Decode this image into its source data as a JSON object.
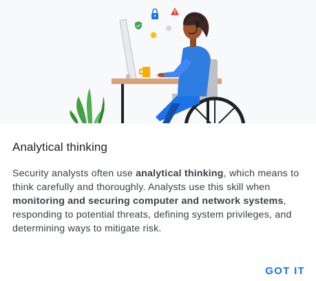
{
  "illustration": {
    "icons": [
      "shield-check-icon",
      "lock-icon",
      "warning-icon",
      "bug-icon",
      "gear-icon"
    ],
    "colors": {
      "background": "#f8f9fa",
      "shirt": "#2f7de1",
      "desk": "#d9a37a",
      "plant": "#4caf50",
      "mug": "#f9ab00",
      "wheelchair": "#202124"
    }
  },
  "dialog": {
    "title": "Analytical thinking",
    "body": {
      "p1": "Security analysts often use ",
      "b1": "analytical thinking",
      "p2": ", which means to think carefully and thoroughly. Analysts use this skill when ",
      "b2": "monitoring and securing computer and network systems",
      "p3": ", responding to potential threats, defining system privileges, and determining ways to mitigate risk."
    },
    "button_label": "GOT IT"
  },
  "colors": {
    "accent": "#1a73e8",
    "text_primary": "#202124",
    "text_secondary": "#3c4043"
  }
}
